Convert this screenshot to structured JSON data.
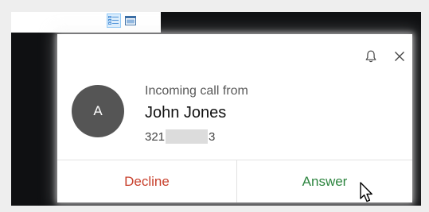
{
  "toolbar": {
    "buttons": [
      {
        "icon": "details-view-icon",
        "active": true
      },
      {
        "icon": "preview-pane-icon",
        "active": false
      }
    ]
  },
  "notification": {
    "controls": {
      "bell_icon": "bell-icon",
      "close_icon": "close-icon"
    },
    "avatar_initial": "A",
    "caption": "Incoming call from",
    "caller_name": "John Jones",
    "phone_prefix": "321",
    "phone_suffix": "3",
    "decline_label": "Decline",
    "answer_label": "Answer"
  },
  "colors": {
    "decline": "#c8402c",
    "answer": "#2e8540",
    "avatar": "#555555",
    "backdrop": "#0f1012"
  }
}
